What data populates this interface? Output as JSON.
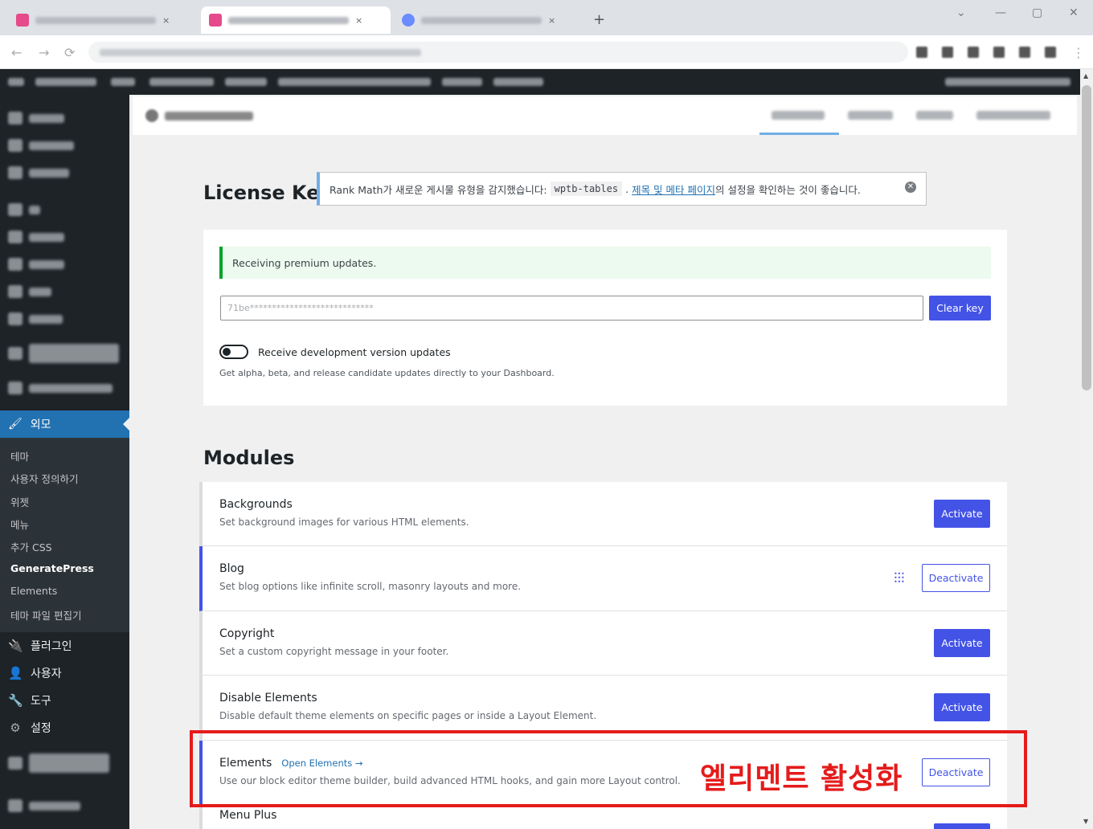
{
  "browser": {
    "new_tab_symbol": "+",
    "tab_close_symbol": "×"
  },
  "sidebar": {
    "active_menu": "외모",
    "submenu": [
      "테마",
      "사용자 정의하기",
      "위젯",
      "메뉴",
      "추가 CSS",
      "GeneratePress",
      "Elements",
      "테마 파일 편집기"
    ],
    "current_submenu": "GeneratePress",
    "menu_after": [
      {
        "label": "플러그인",
        "icon": "plugin-icon"
      },
      {
        "label": "사용자",
        "icon": "user-icon"
      },
      {
        "label": "도구",
        "icon": "wrench-icon"
      },
      {
        "label": "설정",
        "icon": "settings-icon"
      }
    ]
  },
  "license": {
    "title": "License Key",
    "success_message": "Receiving premium updates.",
    "key_value": "71be****************************",
    "clear_key_label": "Clear key",
    "dev_updates_label": "Receive development version updates",
    "dev_updates_desc": "Get alpha, beta, and release candidate updates directly to your Dashboard."
  },
  "notice": {
    "text_before": "Rank Math가 새로운 게시물 유형을 감지했습니다:",
    "code": "wptb-tables",
    "period": ".",
    "link": "제목 및 메타 페이지",
    "text_after": "의 설정을 확인하는 것이 좋습니다."
  },
  "modules": {
    "title": "Modules",
    "items": [
      {
        "name": "Backgrounds",
        "desc": "Set background images for various HTML elements.",
        "action": "Activate",
        "active": false
      },
      {
        "name": "Blog",
        "desc": "Set blog options like infinite scroll, masonry layouts and more.",
        "action": "Deactivate",
        "active": true
      },
      {
        "name": "Copyright",
        "desc": "Set a custom copyright message in your footer.",
        "action": "Activate",
        "active": false
      },
      {
        "name": "Disable Elements",
        "desc": "Disable default theme elements on specific pages or inside a Layout Element.",
        "action": "Activate",
        "active": false
      },
      {
        "name": "Elements",
        "link": "Open Elements →",
        "desc": "Use our block editor theme builder, build advanced HTML hooks, and gain more Layout control.",
        "action": "Deactivate",
        "active": true
      },
      {
        "name": "Menu Plus"
      }
    ]
  },
  "annotation": {
    "text": "엘리멘트 활성화",
    "color": "#e51b1b"
  },
  "colors": {
    "accent": "#4353e6",
    "wp_blue": "#2271b1",
    "admin_dark": "#1d2327"
  }
}
